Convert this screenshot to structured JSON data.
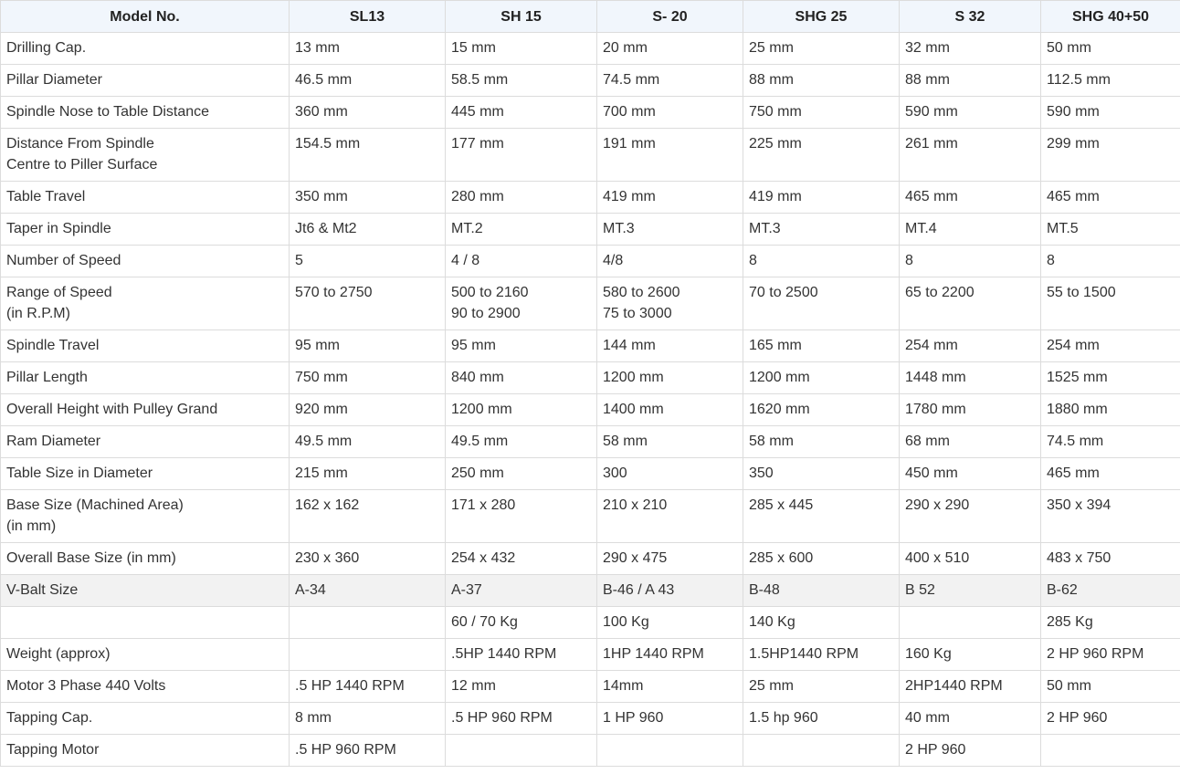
{
  "table": {
    "headers": [
      "Model No.",
      "SL13",
      "SH 15",
      "S- 20",
      "SHG 25",
      "S 32",
      "SHG 40+50"
    ],
    "rows": [
      {
        "cells": [
          [
            "Drilling Cap."
          ],
          [
            "13 mm"
          ],
          [
            "15 mm"
          ],
          [
            "20 mm"
          ],
          [
            "25 mm"
          ],
          [
            "32 mm"
          ],
          [
            "50 mm"
          ]
        ]
      },
      {
        "cells": [
          [
            "Pillar Diameter"
          ],
          [
            "46.5 mm"
          ],
          [
            "58.5 mm"
          ],
          [
            "74.5 mm"
          ],
          [
            "88 mm"
          ],
          [
            "88 mm"
          ],
          [
            "112.5 mm"
          ]
        ]
      },
      {
        "cells": [
          [
            "Spindle Nose to Table Distance"
          ],
          [
            "360 mm"
          ],
          [
            "445 mm"
          ],
          [
            "700 mm"
          ],
          [
            "750 mm"
          ],
          [
            "590 mm"
          ],
          [
            "590 mm"
          ]
        ]
      },
      {
        "cells": [
          [
            "Distance From Spindle",
            "Centre to Piller Surface"
          ],
          [
            "154.5 mm"
          ],
          [
            "177 mm"
          ],
          [
            "191 mm"
          ],
          [
            "225 mm"
          ],
          [
            "261 mm"
          ],
          [
            "299 mm"
          ]
        ]
      },
      {
        "cells": [
          [
            "Table Travel"
          ],
          [
            "350 mm"
          ],
          [
            "280 mm"
          ],
          [
            "419 mm"
          ],
          [
            "419 mm"
          ],
          [
            "465 mm"
          ],
          [
            "465 mm"
          ]
        ]
      },
      {
        "cells": [
          [
            "Taper in Spindle"
          ],
          [
            "Jt6 & Mt2"
          ],
          [
            "MT.2"
          ],
          [
            "MT.3"
          ],
          [
            "MT.3"
          ],
          [
            "MT.4"
          ],
          [
            "MT.5"
          ]
        ]
      },
      {
        "cells": [
          [
            "Number of Speed"
          ],
          [
            "5"
          ],
          [
            "4 / 8"
          ],
          [
            "4/8"
          ],
          [
            "8"
          ],
          [
            "8"
          ],
          [
            "8"
          ]
        ]
      },
      {
        "cells": [
          [
            "Range of Speed",
            "(in R.P.M)"
          ],
          [
            "570 to 2750"
          ],
          [
            "500 to 2160",
            "90 to 2900"
          ],
          [
            "580 to 2600",
            "75 to 3000"
          ],
          [
            "70 to 2500"
          ],
          [
            "65 to 2200"
          ],
          [
            "55 to 1500"
          ]
        ]
      },
      {
        "cells": [
          [
            "Spindle Travel"
          ],
          [
            "95 mm"
          ],
          [
            "95 mm"
          ],
          [
            "144 mm"
          ],
          [
            "165 mm"
          ],
          [
            "254 mm"
          ],
          [
            "254 mm"
          ]
        ]
      },
      {
        "cells": [
          [
            "Pillar Length"
          ],
          [
            "750 mm"
          ],
          [
            "840 mm"
          ],
          [
            "1200 mm"
          ],
          [
            "1200 mm"
          ],
          [
            "1448 mm"
          ],
          [
            "1525 mm"
          ]
        ]
      },
      {
        "cells": [
          [
            "Overall Height with Pulley Grand"
          ],
          [
            "920 mm"
          ],
          [
            "1200 mm"
          ],
          [
            "1400 mm"
          ],
          [
            "1620 mm"
          ],
          [
            "1780 mm"
          ],
          [
            "1880 mm"
          ]
        ]
      },
      {
        "cells": [
          [
            "Ram Diameter"
          ],
          [
            "49.5 mm"
          ],
          [
            "49.5 mm"
          ],
          [
            "58 mm"
          ],
          [
            "58 mm"
          ],
          [
            "68 mm"
          ],
          [
            "74.5 mm"
          ]
        ]
      },
      {
        "cells": [
          [
            "Table Size in Diameter"
          ],
          [
            "215 mm"
          ],
          [
            "250 mm"
          ],
          [
            "300"
          ],
          [
            "350"
          ],
          [
            "450 mm"
          ],
          [
            "465 mm"
          ]
        ]
      },
      {
        "cells": [
          [
            "Base Size (Machined Area)",
            "(in mm)"
          ],
          [
            "162 x 162"
          ],
          [
            "171 x 280"
          ],
          [
            "210 x 210"
          ],
          [
            "285 x 445"
          ],
          [
            "290 x 290"
          ],
          [
            "350 x 394"
          ]
        ]
      },
      {
        "cells": [
          [
            "Overall Base Size (in mm)"
          ],
          [
            "230 x 360"
          ],
          [
            "254 x 432"
          ],
          [
            "290 x 475"
          ],
          [
            "285 x 600"
          ],
          [
            "400 x 510"
          ],
          [
            "483 x 750"
          ]
        ]
      },
      {
        "cells": [
          [
            "V-Balt Size"
          ],
          [
            "A-34"
          ],
          [
            "A-37"
          ],
          [
            "B-46 / A 43"
          ],
          [
            "B-48"
          ],
          [
            "B 52"
          ],
          [
            "B-62"
          ]
        ],
        "shaded": true
      },
      {
        "cells": [
          [
            ""
          ],
          [
            ""
          ],
          [
            "60 / 70 Kg"
          ],
          [
            "100 Kg"
          ],
          [
            "140 Kg"
          ],
          [
            ""
          ],
          [
            "285 Kg"
          ]
        ]
      },
      {
        "cells": [
          [
            "Weight (approx)"
          ],
          [
            ""
          ],
          [
            ".5HP 1440 RPM"
          ],
          [
            "1HP 1440 RPM"
          ],
          [
            "1.5HP1440 RPM"
          ],
          [
            "160 Kg"
          ],
          [
            "2 HP 960 RPM"
          ]
        ]
      },
      {
        "cells": [
          [
            "Motor 3 Phase 440 Volts"
          ],
          [
            ".5 HP 1440 RPM"
          ],
          [
            "12 mm"
          ],
          [
            "14mm"
          ],
          [
            "25 mm"
          ],
          [
            "2HP1440 RPM"
          ],
          [
            "50 mm"
          ]
        ]
      },
      {
        "cells": [
          [
            "Tapping Cap."
          ],
          [
            "8 mm"
          ],
          [
            ".5 HP 960 RPM"
          ],
          [
            "1 HP 960"
          ],
          [
            "1.5 hp 960"
          ],
          [
            "40 mm"
          ],
          [
            "2 HP 960"
          ]
        ]
      },
      {
        "cells": [
          [
            "Tapping Motor"
          ],
          [
            ".5 HP 960 RPM"
          ],
          [
            ""
          ],
          [
            ""
          ],
          [
            ""
          ],
          [
            "2 HP 960"
          ],
          [
            ""
          ]
        ]
      }
    ]
  }
}
